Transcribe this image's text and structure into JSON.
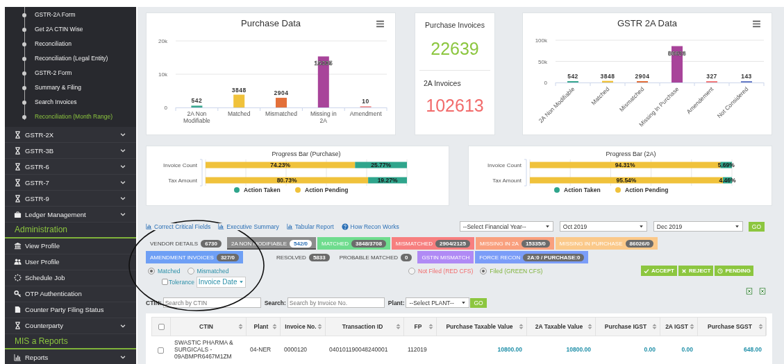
{
  "sidebar": {
    "submenu": [
      {
        "label": "GSTR-2A Form",
        "selected": false
      },
      {
        "label": "Get 2A CTIN Wise",
        "selected": false
      },
      {
        "label": "Reconciliation",
        "selected": false
      },
      {
        "label": "Reconciliation (Legal Entity)",
        "selected": false
      },
      {
        "label": "GSTR-2 Form",
        "selected": false
      },
      {
        "label": "Summary & Filing",
        "selected": false
      },
      {
        "label": "Search Invoices",
        "selected": false
      },
      {
        "label": "Reconciliation (Month Range)",
        "selected": true
      }
    ],
    "items": [
      {
        "kind": "menu",
        "label": "GSTR-2X",
        "expandable": true
      },
      {
        "kind": "menu",
        "label": "GSTR-3B",
        "expandable": true
      },
      {
        "kind": "menu",
        "label": "GSTR-6",
        "expandable": true
      },
      {
        "kind": "menu",
        "label": "GSTR-7",
        "expandable": true
      },
      {
        "kind": "menu",
        "label": "GSTR-9",
        "expandable": true
      },
      {
        "kind": "menu",
        "label": "Ledger Management",
        "expandable": true
      },
      {
        "kind": "section",
        "label": "Administration"
      },
      {
        "kind": "menu",
        "label": "View Profile",
        "expandable": false
      },
      {
        "kind": "menu",
        "label": "User Profile",
        "expandable": false
      },
      {
        "kind": "menu",
        "label": "Schedule Job",
        "expandable": false
      },
      {
        "kind": "menu",
        "label": "OTP Authentication",
        "expandable": false
      },
      {
        "kind": "menu",
        "label": "Counter Party Filing Status",
        "expandable": false
      },
      {
        "kind": "menu",
        "label": "Counterparty",
        "expandable": true
      },
      {
        "kind": "section",
        "label": "MIS a Reports"
      },
      {
        "kind": "menu",
        "label": "Reports",
        "expandable": true
      }
    ]
  },
  "purchase_chart": {
    "chart_data": {
      "type": "bar",
      "title": "Purchase Data",
      "categories": [
        "2A Non Modifiable",
        "Matched",
        "Mismatched",
        "Missing in 2A",
        "Amendment"
      ],
      "values": [
        542,
        3848,
        2904,
        15335,
        10
      ],
      "ylim": [
        0,
        20000
      ],
      "colors": [
        "#3aa88f",
        "#f0c23b",
        "#e3703a",
        "#a8449a",
        "#f2a0a0"
      ],
      "yticks": [
        {
          "value": 0,
          "label": "0"
        },
        {
          "value": 10000,
          "label": "10k"
        },
        {
          "value": 20000,
          "label": "20k"
        }
      ],
      "data_labels": true
    }
  },
  "stats": [
    {
      "label": "Purchase Invoices",
      "value": "22639",
      "color": "#8cc63f"
    },
    {
      "label": "2A Invoices",
      "value": "102613",
      "color": "#f26b6b"
    }
  ],
  "gstr2a_chart": {
    "chart_data": {
      "type": "bar",
      "title": "GSTR 2A Data",
      "categories": [
        "2A Non Modifiable",
        "Matched",
        "Mismatched",
        "Missing In Purchase",
        "Amendement",
        "Not Considered"
      ],
      "values": [
        542,
        3848,
        2904,
        86026,
        327,
        143
      ],
      "ylim": [
        0,
        100000
      ],
      "colors": [
        "#3aa88f",
        "#f0c23b",
        "#e3703a",
        "#a8449a",
        "#f27c7c",
        "#6c80c8"
      ],
      "yticks": [
        {
          "value": 0,
          "label": "0"
        },
        {
          "value": 50000,
          "label": "50k"
        },
        {
          "value": 100000,
          "label": "100k"
        }
      ],
      "data_labels": true
    }
  },
  "progress_purchase": {
    "chart_data": {
      "type": "bar",
      "orientation": "horizontal",
      "stacked": true,
      "legend": "bottom",
      "title": "Progress Bar (Purchase)",
      "categories": [
        "Invoice Count",
        "Tax Amount"
      ],
      "xlim": [
        0,
        100
      ],
      "series": [
        {
          "name": "Action Pending",
          "color": "#f0c23b",
          "values": [
            74.23,
            80.73
          ],
          "value_labels": [
            "74.23%",
            "80.73%"
          ]
        },
        {
          "name": "Action Taken",
          "color": "#2fa58c",
          "values": [
            25.77,
            19.27
          ],
          "value_labels": [
            "25.77%",
            "19.27%"
          ]
        }
      ]
    }
  },
  "progress_2a": {
    "chart_data": {
      "type": "bar",
      "orientation": "horizontal",
      "stacked": true,
      "legend": "bottom",
      "title": "Progress Bar (2A)",
      "categories": [
        "Invoice Count",
        "Tax Amount"
      ],
      "xlim": [
        0,
        100
      ],
      "series": [
        {
          "name": "Action Pending",
          "color": "#f0c23b",
          "values": [
            94.31,
            95.54
          ],
          "value_labels": [
            "94.31%",
            "95.54%"
          ]
        },
        {
          "name": "Action Taken",
          "color": "#2fa58c",
          "values": [
            5.69,
            4.46
          ],
          "value_labels": [
            "5.69%",
            "4.46%"
          ]
        }
      ]
    }
  },
  "links": [
    {
      "kind": "report",
      "label": "Correct Critical Fields"
    },
    {
      "kind": "report",
      "label": "Executive Summary"
    },
    {
      "kind": "report",
      "label": "Tabular Report"
    },
    {
      "kind": "help",
      "label": "How Recon Works"
    }
  ],
  "period": [
    {
      "value": "--Select Financial Year--"
    },
    {
      "value": "Oct 2019"
    },
    {
      "value": "Dec 2019"
    }
  ],
  "period_go": "GO",
  "status_rows": [
    {
      "tabs": [
        {
          "label": "VENDOR DETAILS",
          "count": "6730",
          "selected": false
        },
        {
          "label": "2A NON MODIFIABLE",
          "count": "542/0",
          "color": "#8c8c8c",
          "selected": true
        },
        {
          "label": "MATCHED",
          "count": "3848/3708",
          "color": "#6fdc8e",
          "selected": false
        },
        {
          "label": "MISMATCHED",
          "count": "2904/2125",
          "color": "#f77f7f",
          "selected": false
        },
        {
          "label": "MISSING IN 2A",
          "count": "15335/0",
          "color": "#f9a07e",
          "selected": false
        },
        {
          "label": "MISSING IN PURCHASE",
          "count": "86026/0",
          "color": "#fbc98a",
          "selected": false
        }
      ]
    },
    {
      "tabs": [
        {
          "label": "AMENDMENT INVOICES",
          "count": "327/0",
          "color": "#6e9ff5",
          "selected": false
        },
        {
          "label": "RESOLVED",
          "count": "5833",
          "selected": false
        },
        {
          "label": "PROBABLE MATCHED",
          "count": "0",
          "selected": false
        },
        {
          "label": "GSTIN MISMATCH",
          "color": "#b08af5",
          "selected": false
        },
        {
          "label": "FORCE RECON",
          "count": "2A:0 / PURCHASE:0",
          "color": "#7b9df8",
          "selected": false
        }
      ]
    }
  ],
  "match_filter": [
    {
      "label": "Matched",
      "selected": true
    },
    {
      "label": "Mismatched",
      "selected": false
    }
  ],
  "filing_filter": [
    {
      "label": "Not Filed (RED CFS)",
      "selected": false
    },
    {
      "label": "Filed (GREEN CFS)",
      "selected": true
    }
  ],
  "actions": [
    {
      "kind": "accept",
      "label": "ACCEPT"
    },
    {
      "kind": "reject",
      "label": "REJECT"
    },
    {
      "kind": "pending",
      "label": "PENDING"
    }
  ],
  "tolerance": {
    "label": "Tolerance",
    "checked": false,
    "field": "Invoice Date"
  },
  "search": {
    "ctin_label": "CTIN:",
    "ctin_placeholder": "Search by CTIN",
    "search_label": "Search:",
    "search_placeholder": "Search by Invoice No.",
    "plant_label": "Plant:",
    "plant": "--Select PLANT--",
    "go": "GO"
  },
  "table": {
    "select_all": false,
    "columns": [
      {
        "label": "CTIN",
        "kind": "text",
        "sortable": true
      },
      {
        "label": "Plant",
        "kind": "text",
        "sortable": true
      },
      {
        "label": "Invoice No.",
        "kind": "text",
        "sortable": true
      },
      {
        "label": "Transaction ID",
        "kind": "text",
        "sortable": true
      },
      {
        "label": "FP",
        "kind": "text",
        "sortable": true
      },
      {
        "label": "Purchase Taxable Value",
        "kind": "number",
        "sortable": true
      },
      {
        "label": "2A Taxable Value",
        "kind": "number",
        "sortable": true
      },
      {
        "label": "Purchase IGST",
        "kind": "number",
        "sortable": true
      },
      {
        "label": "2A IGST",
        "kind": "number",
        "sortable": true
      },
      {
        "label": "Purchase SGST",
        "kind": "number",
        "sortable": true
      }
    ],
    "rows": [
      {
        "selected": false,
        "cells": [
          "SWASTIC PHARMA & SURGICALS - 09ABMPR6467M1ZM",
          "04-NER",
          "0000120",
          "040101190048240001",
          "112019",
          "10800.00",
          "10800.00",
          "0.00",
          "0.00",
          "648.00"
        ]
      }
    ]
  }
}
